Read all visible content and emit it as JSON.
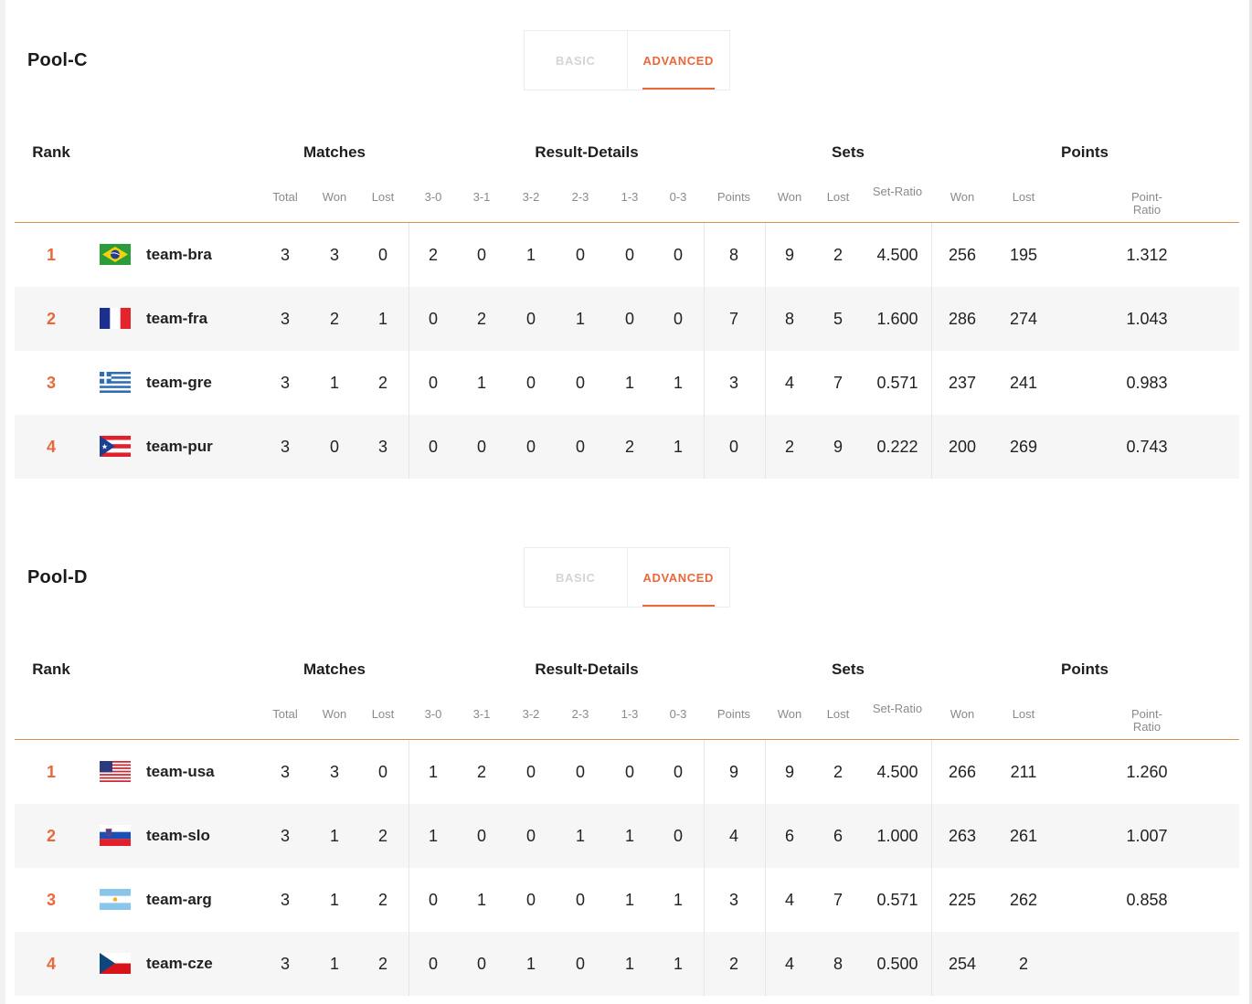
{
  "pools": [
    {
      "title": "Pool-C",
      "toggle": {
        "basic": "BASIC",
        "advanced": "ADVANCED",
        "active": "advanced"
      },
      "groups": {
        "rank": "Rank",
        "matches": "Matches",
        "result_details": "Result-Details",
        "sets": "Sets",
        "points": "Points"
      },
      "columns": [
        "Total",
        "Won",
        "Lost",
        "3-0",
        "3-1",
        "3-2",
        "2-3",
        "1-3",
        "0-3",
        "Points",
        "Won",
        "Lost",
        "Set-Ratio",
        "Won",
        "Lost",
        "Point-Ratio"
      ],
      "rows": [
        {
          "rank": "1",
          "flag": "brazil-flag-icon",
          "team": "team-bra",
          "values": [
            "3",
            "3",
            "0",
            "2",
            "0",
            "1",
            "0",
            "0",
            "0",
            "8",
            "9",
            "2",
            "4.500",
            "256",
            "195",
            "1.312"
          ]
        },
        {
          "rank": "2",
          "flag": "france-flag-icon",
          "team": "team-fra",
          "values": [
            "3",
            "2",
            "1",
            "0",
            "2",
            "0",
            "1",
            "0",
            "0",
            "7",
            "8",
            "5",
            "1.600",
            "286",
            "274",
            "1.043"
          ]
        },
        {
          "rank": "3",
          "flag": "greece-flag-icon",
          "team": "team-gre",
          "values": [
            "3",
            "1",
            "2",
            "0",
            "1",
            "0",
            "0",
            "1",
            "1",
            "3",
            "4",
            "7",
            "0.571",
            "237",
            "241",
            "0.983"
          ]
        },
        {
          "rank": "4",
          "flag": "puerto-rico-flag-icon",
          "team": "team-pur",
          "values": [
            "3",
            "0",
            "3",
            "0",
            "0",
            "0",
            "0",
            "2",
            "1",
            "0",
            "2",
            "9",
            "0.222",
            "200",
            "269",
            "0.743"
          ]
        }
      ]
    },
    {
      "title": "Pool-D",
      "toggle": {
        "basic": "BASIC",
        "advanced": "ADVANCED",
        "active": "advanced"
      },
      "groups": {
        "rank": "Rank",
        "matches": "Matches",
        "result_details": "Result-Details",
        "sets": "Sets",
        "points": "Points"
      },
      "columns": [
        "Total",
        "Won",
        "Lost",
        "3-0",
        "3-1",
        "3-2",
        "2-3",
        "1-3",
        "0-3",
        "Points",
        "Won",
        "Lost",
        "Set-Ratio",
        "Won",
        "Lost",
        "Point-Ratio"
      ],
      "rows": [
        {
          "rank": "1",
          "flag": "usa-flag-icon",
          "team": "team-usa",
          "values": [
            "3",
            "3",
            "0",
            "1",
            "2",
            "0",
            "0",
            "0",
            "0",
            "9",
            "9",
            "2",
            "4.500",
            "266",
            "211",
            "1.260"
          ]
        },
        {
          "rank": "2",
          "flag": "slovenia-flag-icon",
          "team": "team-slo",
          "values": [
            "3",
            "1",
            "2",
            "1",
            "0",
            "0",
            "1",
            "1",
            "0",
            "4",
            "6",
            "6",
            "1.000",
            "263",
            "261",
            "1.007"
          ]
        },
        {
          "rank": "3",
          "flag": "argentina-flag-icon",
          "team": "team-arg",
          "values": [
            "3",
            "1",
            "2",
            "0",
            "1",
            "0",
            "0",
            "1",
            "1",
            "3",
            "4",
            "7",
            "0.571",
            "225",
            "262",
            "0.858"
          ]
        },
        {
          "rank": "4",
          "flag": "czechia-flag-icon",
          "team": "team-cze",
          "values": [
            "3",
            "1",
            "2",
            "0",
            "0",
            "1",
            "0",
            "1",
            "1",
            "2",
            "4",
            "8",
            "0.500",
            "254",
            "2",
            ""
          ]
        }
      ]
    }
  ],
  "colors": {
    "accent": "#e8683a",
    "rule": "#d9924f",
    "row_alt": "#f6f6f6",
    "muted": "#8a8a8a",
    "toggle_inactive": "#d4d4d4"
  }
}
